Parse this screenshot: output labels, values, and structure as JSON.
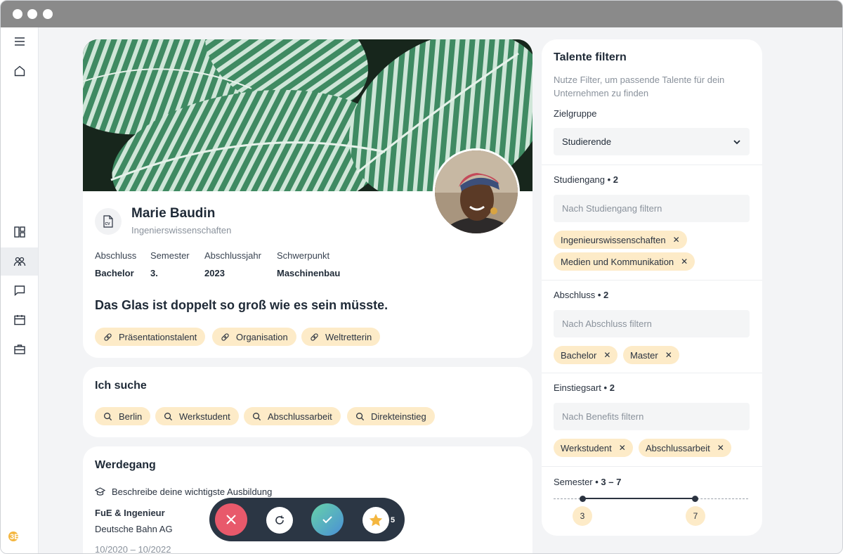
{
  "sidebar": {
    "items": [
      {
        "icon": "menu-icon"
      },
      {
        "icon": "home-icon"
      },
      {
        "icon": "dashboard-icon"
      },
      {
        "icon": "talents-icon"
      },
      {
        "icon": "chat-icon"
      },
      {
        "icon": "calendar-icon"
      },
      {
        "icon": "briefcase-icon"
      }
    ],
    "logo_text": "3EG"
  },
  "profile": {
    "name": "Marie Baudin",
    "field": "Ingenierswissenschaften",
    "cv_label": "CV",
    "meta": [
      {
        "label": "Abschluss",
        "value": "Bachelor"
      },
      {
        "label": "Semester",
        "value": "3."
      },
      {
        "label": "Abschlussjahr",
        "value": "2023"
      },
      {
        "label": "Schwerpunkt",
        "value": "Maschinenbau"
      }
    ],
    "quote": "Das Glas ist doppelt so groß wie es sein müsste.",
    "traits": [
      "Präsentationstalent",
      "Organisation",
      "Weltretterin"
    ]
  },
  "seeking": {
    "title": "Ich suche",
    "items": [
      "Berlin",
      "Werkstudent",
      "Abschlussarbeit",
      "Direkteinstieg"
    ]
  },
  "career": {
    "title": "Werdegang",
    "hint": "Beschreibe deine wichtigste Ausbildung",
    "role": "FuE & Ingenieur",
    "company": "Deutsche Bahn AG",
    "period": "10/2020 – 10/2022"
  },
  "actions": {
    "badge_count": "5"
  },
  "filters": {
    "title": "Talente filtern",
    "description": "Nutze Filter, um passende Talente für dein Unternehmen zu finden",
    "target_group": {
      "label": "Zielgruppe",
      "value": "Studierende"
    },
    "study": {
      "label": "Studiengang",
      "count": "• 2",
      "placeholder": "Nach Studiengang filtern",
      "tags": [
        "Ingenieurswissenschaften",
        "Medien und Kommunikation"
      ]
    },
    "degree": {
      "label": "Abschluss",
      "count": "• 2",
      "placeholder": "Nach Abschluss filtern",
      "tags": [
        "Bachelor",
        "Master"
      ]
    },
    "entry": {
      "label": "Einstiegsart",
      "count": "• 2",
      "placeholder": "Nach Benefits filtern",
      "tags": [
        "Werkstudent",
        "Abschlussarbeit"
      ]
    },
    "semester": {
      "label": "Semester",
      "range": "• 3 – 7",
      "min": "3",
      "max": "7"
    }
  },
  "colors": {
    "chip": "#fdebc8",
    "dark": "#2b3644",
    "reject": "#e8596b",
    "accept": "#4fb7a9"
  }
}
